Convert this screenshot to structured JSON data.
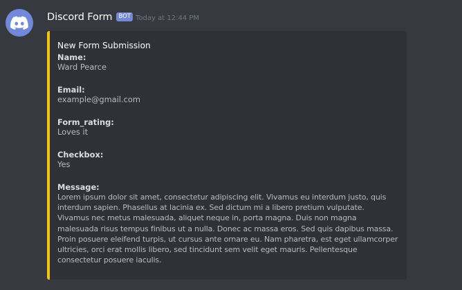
{
  "message": {
    "author": "Discord Form",
    "tag": "BOT",
    "timestamp": "Today at 12:44 PM"
  },
  "embed": {
    "accent_color": "#f1c40f",
    "title": "New Form Submission",
    "fields": [
      {
        "name": "Name:",
        "value": "Ward Pearce"
      },
      {
        "name": "Email:",
        "value": "example@gmail.com"
      },
      {
        "name": "Form_rating:",
        "value": "Loves it"
      },
      {
        "name": "Checkbox:",
        "value": "Yes"
      },
      {
        "name": "Message:",
        "value": "Lorem ipsum dolor sit amet, consectetur adipiscing elit. Vivamus eu interdum justo, quis interdum sapien. Phasellus at lacinia ex. Sed dictum mi a libero pretium vulputate. Vivamus nec metus malesuada, aliquet neque in, porta magna. Duis non magna malesuada risus tempus finibus ut a nulla. Donec ac massa eros. Sed quis dapibus massa. Proin posuere eleifend turpis, ut cursus ante ornare eu. Nam pharetra, est eget ullamcorper ultricies, orci erat mollis libero, sed tincidunt sem velit eget mauris. Pellentesque consectetur posuere iaculis."
      }
    ]
  },
  "icons": {
    "avatar": "discord-logo-icon"
  },
  "colors": {
    "background": "#36393f",
    "embed_background": "#2f3136",
    "avatar": "#7289da",
    "bot_tag": "#7289da"
  }
}
